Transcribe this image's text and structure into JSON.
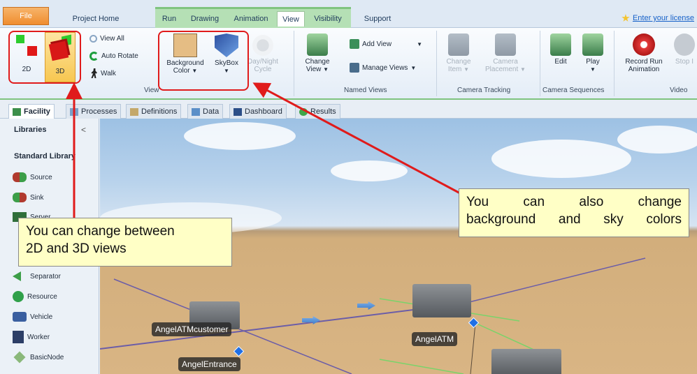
{
  "tabs": {
    "file": "File",
    "items": [
      "Project Home",
      "Run",
      "Drawing",
      "Animation",
      "View",
      "Visibility",
      "Support"
    ],
    "active": "View"
  },
  "license_link": "Enter your license",
  "ribbon": {
    "view_group": {
      "label": "View",
      "btn_2d": "2D",
      "btn_3d": "3D",
      "view_all": "View All",
      "auto_rotate": "Auto Rotate",
      "walk": "Walk"
    },
    "background_color": {
      "line1": "Background",
      "line2": "Color"
    },
    "skybox": "SkyBox",
    "day_night": {
      "line1": "Day/Night",
      "line2": "Cycle"
    },
    "named_views": {
      "label": "Named Views",
      "change_view": {
        "line1": "Change",
        "line2": "View"
      },
      "add_view": "Add View",
      "manage_views": "Manage Views"
    },
    "camera_tracking": {
      "label": "Camera Tracking",
      "change_item": {
        "line1": "Change",
        "line2": "Item"
      },
      "camera_placement": {
        "line1": "Camera",
        "line2": "Placement"
      }
    },
    "camera_sequences": {
      "label": "Camera Sequences",
      "edit": "Edit",
      "play": "Play"
    },
    "video": {
      "label": "Video",
      "record": {
        "line1": "Record Run",
        "line2": "Animation"
      },
      "stop": "Stop I"
    }
  },
  "doc_tabs": [
    "Facility",
    "Processes",
    "Definitions",
    "Data",
    "Dashboard",
    "Results"
  ],
  "sidebar": {
    "header": "Libraries",
    "collapse": "<",
    "section": "Standard Library",
    "items": [
      "Source",
      "Sink",
      "Server",
      "Separator",
      "Resource",
      "Vehicle",
      "Worker",
      "BasicNode"
    ]
  },
  "scene": {
    "labels": [
      "AngelATMcustomer",
      "AngelATM",
      "AngelEntrance"
    ]
  },
  "callouts": {
    "left": {
      "line1": "You can change between",
      "line2": "2D and 3D views"
    },
    "right": {
      "line1": "You   can   also   change",
      "line2": "background and sky colors"
    }
  },
  "colors": {
    "highlight": "#e01b1b",
    "callout_bg": "#ffffc6",
    "context_tab": "#b5e0b5",
    "background_swatch": "#e5bd84"
  }
}
